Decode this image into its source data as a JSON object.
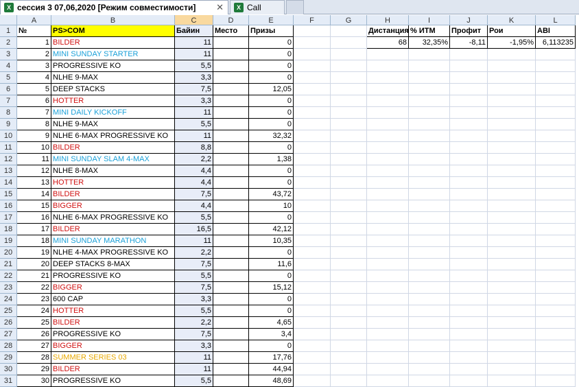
{
  "tabs": [
    {
      "label": "сессия 3 07,06,2020  [Режим совместимости]",
      "icon": "excel-icon",
      "close": "✕"
    },
    {
      "label": "Call",
      "icon": "excel-icon"
    }
  ],
  "columns": [
    "A",
    "B",
    "C",
    "D",
    "E",
    "F",
    "G",
    "H",
    "I",
    "J",
    "K",
    "L"
  ],
  "selected_column": "C",
  "header_row": {
    "A": "№",
    "B": "PS>COM",
    "C": "Байин",
    "D": "Место",
    "E": "Призы",
    "H": "Дистанция",
    "I": "% ИТМ",
    "J": "Профит",
    "K": "Рои",
    "L": "ABI"
  },
  "summary_row": {
    "H": "68",
    "I": "32,35%",
    "J": "-8,11",
    "K": "-1,95%",
    "L": "6,113235"
  },
  "colors": {
    "red": "#d01010",
    "blue": "#1aa0d8",
    "orange": "#e8a800",
    "highlight": "#ffff00"
  },
  "rows": [
    {
      "n": "1",
      "name": "BILDER",
      "color": "red",
      "buyin": "11",
      "prize": "0"
    },
    {
      "n": "2",
      "name": "MINI SUNDAY STARTER",
      "color": "blue",
      "buyin": "11",
      "prize": "0"
    },
    {
      "n": "3",
      "name": "PROGRESSIVE KO",
      "color": "",
      "buyin": "5,5",
      "prize": "0"
    },
    {
      "n": "4",
      "name": "NLHE 9-MAX",
      "color": "",
      "buyin": "3,3",
      "prize": "0"
    },
    {
      "n": "5",
      "name": "DEEP STACKS",
      "color": "",
      "buyin": "7,5",
      "prize": "12,05"
    },
    {
      "n": "6",
      "name": "HOTTER",
      "color": "red",
      "buyin": "3,3",
      "prize": "0"
    },
    {
      "n": "7",
      "name": "MINI DAILY KICKOFF",
      "color": "blue",
      "buyin": "11",
      "prize": "0"
    },
    {
      "n": "8",
      "name": "NLHE 9-MAX",
      "color": "",
      "buyin": "5,5",
      "prize": "0"
    },
    {
      "n": "9",
      "name": "NLHE 6-MAX PROGRESSIVE KO",
      "color": "",
      "buyin": "11",
      "prize": "32,32"
    },
    {
      "n": "10",
      "name": "BILDER",
      "color": "red",
      "buyin": "8,8",
      "prize": "0"
    },
    {
      "n": "11",
      "name": "MINI SUNDAY SLAM 4-MAX",
      "color": "blue",
      "buyin": "2,2",
      "prize": "1,38"
    },
    {
      "n": "12",
      "name": "NLHE 8-MAX",
      "color": "",
      "buyin": "4,4",
      "prize": "0"
    },
    {
      "n": "13",
      "name": "HOTTER",
      "color": "red",
      "buyin": "4,4",
      "prize": "0"
    },
    {
      "n": "14",
      "name": "BILDER",
      "color": "red",
      "buyin": "7,5",
      "prize": "43,72"
    },
    {
      "n": "15",
      "name": "BIGGER",
      "color": "red",
      "buyin": "4,4",
      "prize": "10"
    },
    {
      "n": "16",
      "name": "NLHE 6-MAX PROGRESSIVE KO",
      "color": "",
      "buyin": "5,5",
      "prize": "0"
    },
    {
      "n": "17",
      "name": "BILDER",
      "color": "red",
      "buyin": "16,5",
      "prize": "42,12"
    },
    {
      "n": "18",
      "name": "MINI SUNDAY MARATHON",
      "color": "blue",
      "buyin": "11",
      "prize": "10,35"
    },
    {
      "n": "19",
      "name": "NLHE 4-MAX PROGRESSIVE KO",
      "color": "",
      "buyin": "2,2",
      "prize": "0"
    },
    {
      "n": "20",
      "name": "DEEP STACKS 8-MAX",
      "color": "",
      "buyin": "7,5",
      "prize": "11,6"
    },
    {
      "n": "21",
      "name": "PROGRESSIVE KO",
      "color": "",
      "buyin": "5,5",
      "prize": "0"
    },
    {
      "n": "22",
      "name": "BIGGER",
      "color": "red",
      "buyin": "7,5",
      "prize": "15,12"
    },
    {
      "n": "23",
      "name": "600 CAP",
      "color": "",
      "buyin": "3,3",
      "prize": "0"
    },
    {
      "n": "24",
      "name": "HOTTER",
      "color": "red",
      "buyin": "5,5",
      "prize": "0"
    },
    {
      "n": "25",
      "name": "BILDER",
      "color": "red",
      "buyin": "2,2",
      "prize": "4,65"
    },
    {
      "n": "26",
      "name": "PROGRESSIVE KO",
      "color": "",
      "buyin": "7,5",
      "prize": "3,4"
    },
    {
      "n": "27",
      "name": "BIGGER",
      "color": "red",
      "buyin": "3,3",
      "prize": "0"
    },
    {
      "n": "28",
      "name": "SUMMER SERIES 03",
      "color": "orange",
      "buyin": "11",
      "prize": "17,76"
    },
    {
      "n": "29",
      "name": "BILDER",
      "color": "red",
      "buyin": "11",
      "prize": "44,94"
    },
    {
      "n": "30",
      "name": "PROGRESSIVE KO",
      "color": "",
      "buyin": "5,5",
      "prize": "48,69"
    }
  ]
}
